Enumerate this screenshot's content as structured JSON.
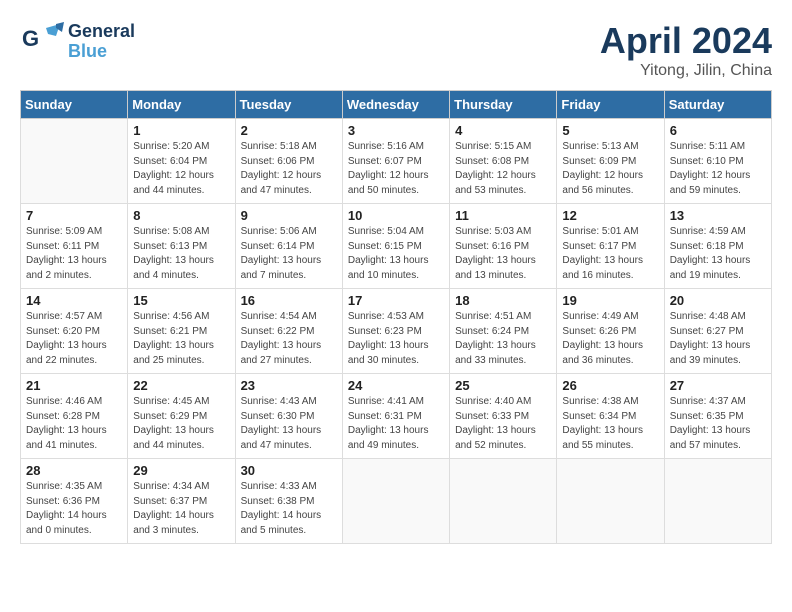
{
  "header": {
    "logo_line1": "General",
    "logo_line2": "Blue",
    "month": "April 2024",
    "location": "Yitong, Jilin, China"
  },
  "weekdays": [
    "Sunday",
    "Monday",
    "Tuesday",
    "Wednesday",
    "Thursday",
    "Friday",
    "Saturday"
  ],
  "weeks": [
    [
      {
        "day": "",
        "info": ""
      },
      {
        "day": "1",
        "info": "Sunrise: 5:20 AM\nSunset: 6:04 PM\nDaylight: 12 hours\nand 44 minutes."
      },
      {
        "day": "2",
        "info": "Sunrise: 5:18 AM\nSunset: 6:06 PM\nDaylight: 12 hours\nand 47 minutes."
      },
      {
        "day": "3",
        "info": "Sunrise: 5:16 AM\nSunset: 6:07 PM\nDaylight: 12 hours\nand 50 minutes."
      },
      {
        "day": "4",
        "info": "Sunrise: 5:15 AM\nSunset: 6:08 PM\nDaylight: 12 hours\nand 53 minutes."
      },
      {
        "day": "5",
        "info": "Sunrise: 5:13 AM\nSunset: 6:09 PM\nDaylight: 12 hours\nand 56 minutes."
      },
      {
        "day": "6",
        "info": "Sunrise: 5:11 AM\nSunset: 6:10 PM\nDaylight: 12 hours\nand 59 minutes."
      }
    ],
    [
      {
        "day": "7",
        "info": "Sunrise: 5:09 AM\nSunset: 6:11 PM\nDaylight: 13 hours\nand 2 minutes."
      },
      {
        "day": "8",
        "info": "Sunrise: 5:08 AM\nSunset: 6:13 PM\nDaylight: 13 hours\nand 4 minutes."
      },
      {
        "day": "9",
        "info": "Sunrise: 5:06 AM\nSunset: 6:14 PM\nDaylight: 13 hours\nand 7 minutes."
      },
      {
        "day": "10",
        "info": "Sunrise: 5:04 AM\nSunset: 6:15 PM\nDaylight: 13 hours\nand 10 minutes."
      },
      {
        "day": "11",
        "info": "Sunrise: 5:03 AM\nSunset: 6:16 PM\nDaylight: 13 hours\nand 13 minutes."
      },
      {
        "day": "12",
        "info": "Sunrise: 5:01 AM\nSunset: 6:17 PM\nDaylight: 13 hours\nand 16 minutes."
      },
      {
        "day": "13",
        "info": "Sunrise: 4:59 AM\nSunset: 6:18 PM\nDaylight: 13 hours\nand 19 minutes."
      }
    ],
    [
      {
        "day": "14",
        "info": "Sunrise: 4:57 AM\nSunset: 6:20 PM\nDaylight: 13 hours\nand 22 minutes."
      },
      {
        "day": "15",
        "info": "Sunrise: 4:56 AM\nSunset: 6:21 PM\nDaylight: 13 hours\nand 25 minutes."
      },
      {
        "day": "16",
        "info": "Sunrise: 4:54 AM\nSunset: 6:22 PM\nDaylight: 13 hours\nand 27 minutes."
      },
      {
        "day": "17",
        "info": "Sunrise: 4:53 AM\nSunset: 6:23 PM\nDaylight: 13 hours\nand 30 minutes."
      },
      {
        "day": "18",
        "info": "Sunrise: 4:51 AM\nSunset: 6:24 PM\nDaylight: 13 hours\nand 33 minutes."
      },
      {
        "day": "19",
        "info": "Sunrise: 4:49 AM\nSunset: 6:26 PM\nDaylight: 13 hours\nand 36 minutes."
      },
      {
        "day": "20",
        "info": "Sunrise: 4:48 AM\nSunset: 6:27 PM\nDaylight: 13 hours\nand 39 minutes."
      }
    ],
    [
      {
        "day": "21",
        "info": "Sunrise: 4:46 AM\nSunset: 6:28 PM\nDaylight: 13 hours\nand 41 minutes."
      },
      {
        "day": "22",
        "info": "Sunrise: 4:45 AM\nSunset: 6:29 PM\nDaylight: 13 hours\nand 44 minutes."
      },
      {
        "day": "23",
        "info": "Sunrise: 4:43 AM\nSunset: 6:30 PM\nDaylight: 13 hours\nand 47 minutes."
      },
      {
        "day": "24",
        "info": "Sunrise: 4:41 AM\nSunset: 6:31 PM\nDaylight: 13 hours\nand 49 minutes."
      },
      {
        "day": "25",
        "info": "Sunrise: 4:40 AM\nSunset: 6:33 PM\nDaylight: 13 hours\nand 52 minutes."
      },
      {
        "day": "26",
        "info": "Sunrise: 4:38 AM\nSunset: 6:34 PM\nDaylight: 13 hours\nand 55 minutes."
      },
      {
        "day": "27",
        "info": "Sunrise: 4:37 AM\nSunset: 6:35 PM\nDaylight: 13 hours\nand 57 minutes."
      }
    ],
    [
      {
        "day": "28",
        "info": "Sunrise: 4:35 AM\nSunset: 6:36 PM\nDaylight: 14 hours\nand 0 minutes."
      },
      {
        "day": "29",
        "info": "Sunrise: 4:34 AM\nSunset: 6:37 PM\nDaylight: 14 hours\nand 3 minutes."
      },
      {
        "day": "30",
        "info": "Sunrise: 4:33 AM\nSunset: 6:38 PM\nDaylight: 14 hours\nand 5 minutes."
      },
      {
        "day": "",
        "info": ""
      },
      {
        "day": "",
        "info": ""
      },
      {
        "day": "",
        "info": ""
      },
      {
        "day": "",
        "info": ""
      }
    ]
  ]
}
